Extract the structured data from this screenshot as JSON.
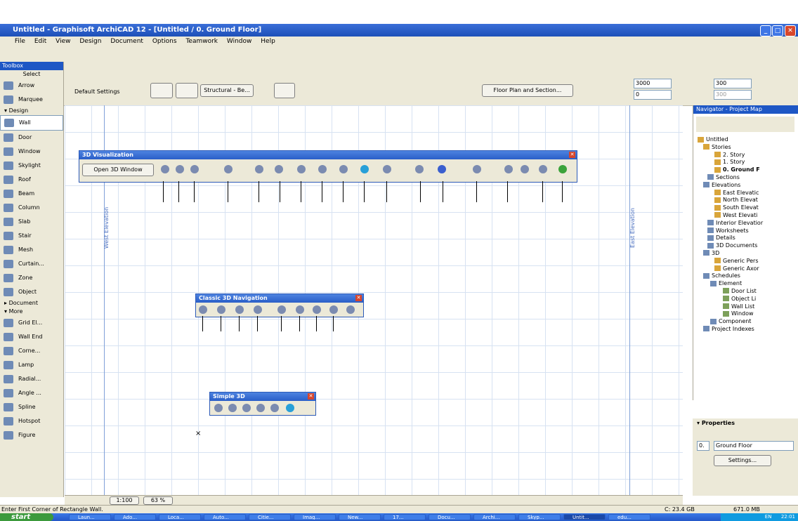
{
  "window": {
    "title": "Untitled - Graphisoft ArchiCAD 12 - [Untitled / 0. Ground Floor]"
  },
  "menu": [
    "File",
    "Edit",
    "View",
    "Design",
    "Document",
    "Options",
    "Teamwork",
    "Window",
    "Help"
  ],
  "infobox": {
    "default_settings": "Default Settings",
    "structural": "Structural - Be...",
    "floor_plan_btn": "Floor Plan and Section...",
    "height1": "3000",
    "height2": "0",
    "thickness": "300",
    "thickness2": "300"
  },
  "toolbox": {
    "title": "Toolbox",
    "select": "Select",
    "arrow": "Arrow",
    "marquee": "Marquee",
    "design_cat": "Design",
    "design_tools": [
      "Wall",
      "Door",
      "Window",
      "Skylight",
      "Roof",
      "Beam",
      "Column",
      "Slab",
      "Stair",
      "Mesh",
      "Curtain...",
      "Zone",
      "Object"
    ],
    "document_cat": "Document",
    "more_cat": "More",
    "more_tools": [
      "Grid El...",
      "Wall End",
      "Corne...",
      "Lamp",
      "Radial...",
      "Angle ...",
      "Spline",
      "Hotspot",
      "Figure"
    ]
  },
  "canvas": {
    "west_elevation": "West Elevation",
    "east_elevation": "East Elevation",
    "viz_palette_title": "3D Visualization",
    "open_3d": "Open 3D Window",
    "classic_title": "Classic 3D Navigation",
    "simple_title": "Simple 3D",
    "marker": "×"
  },
  "navigator": {
    "title": "Navigator - Project Map",
    "tree": [
      "Untitled",
      "Stories",
      "2. Story",
      "1. Story",
      "0. Ground F",
      "Sections",
      "Elevations",
      "East Elevatic",
      "North Elevat",
      "South Elevat",
      "West Elevati",
      "Interior Elevatior",
      "Worksheets",
      "Details",
      "3D Documents",
      "3D",
      "Generic Pers",
      "Generic Axor",
      "Schedules",
      "Element",
      "Door List",
      "Object Li",
      "Wall List",
      "Window",
      "Component",
      "Project Indexes"
    ]
  },
  "properties": {
    "title": "Properties",
    "id": "0.",
    "story": "Ground Floor",
    "settings": "Settings..."
  },
  "bottom": {
    "scale": "1:100",
    "zoom": "63 %"
  },
  "status": {
    "hint": "Enter First Corner of Rectangle Wall.",
    "disk": "C: 23.4 GB",
    "mem": "671.0 MB"
  },
  "taskbar": {
    "start": "start",
    "tasks": [
      "Laun...",
      "Ado...",
      "Loca...",
      "Auto...",
      "Citie...",
      "Imag...",
      "New...",
      "17...",
      "Docu...",
      "Archi...",
      "Skyp...",
      "Untit...",
      "edu..."
    ],
    "clock": "22:01",
    "lang": "EN"
  }
}
